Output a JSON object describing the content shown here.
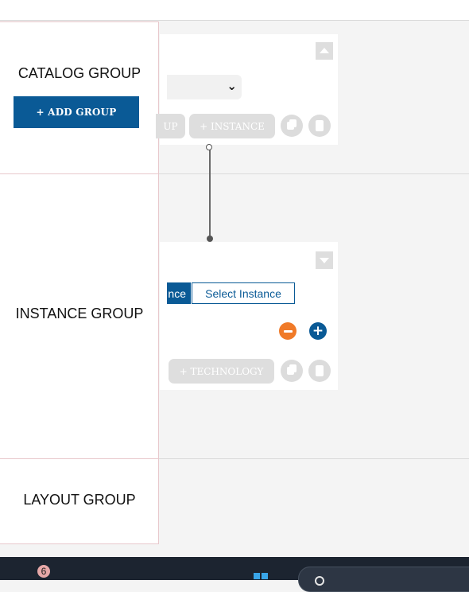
{
  "groups": {
    "catalog": {
      "label": "CATALOG GROUP",
      "add_button": "+ ADD GROUP"
    },
    "instance": {
      "label": "INSTANCE GROUP"
    },
    "layout": {
      "label": "LAYOUT GROUP"
    }
  },
  "catalog_card": {
    "select_value": "",
    "buttons": {
      "group_partial": "UP",
      "instance": "+ INSTANCE"
    }
  },
  "instance_card": {
    "tabs": {
      "active_partial": "nce",
      "select": "Select Instance"
    },
    "buttons": {
      "technology": "+ TECHNOLOGY"
    }
  },
  "colors": {
    "brand_blue": "#0a5a96",
    "remove_orange": "#f07a28",
    "add_blue": "#0a5a96",
    "disabled_gray": "#dedede",
    "taskbar": "#1c2430",
    "badge": "#e7a8a8"
  },
  "taskbar": {
    "notification_count": "6"
  },
  "icons": {
    "collapse_up": "chevron-up-icon",
    "collapse_down": "chevron-down-icon",
    "copy": "copy-icon",
    "delete": "trash-icon",
    "remove": "minus-circle-icon",
    "add": "plus-circle-icon",
    "start": "windows-start-icon",
    "search": "search-icon"
  }
}
